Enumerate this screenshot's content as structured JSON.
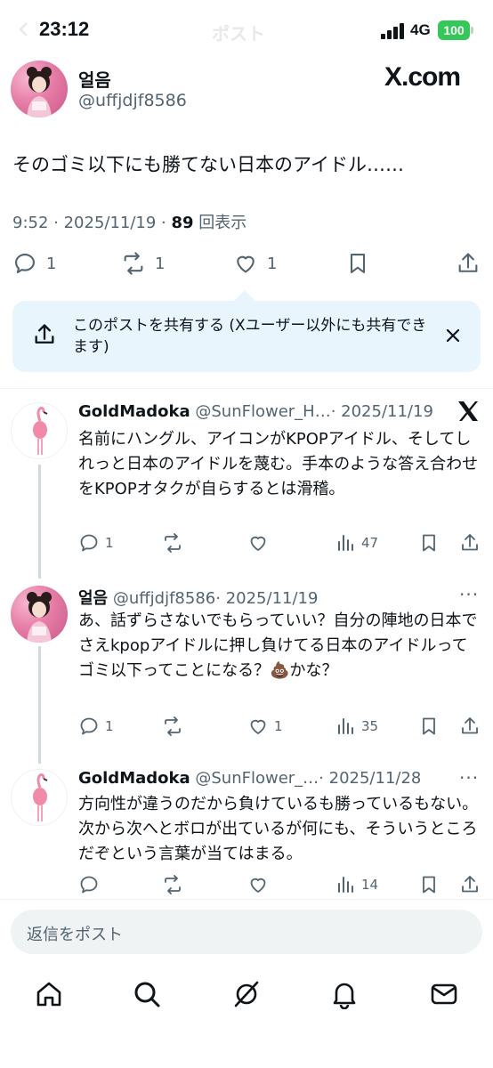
{
  "status_bar": {
    "time": "23:12",
    "screen_title": "ポスト",
    "network": "4G",
    "battery": "100"
  },
  "post": {
    "display_name": "얼음",
    "handle": "@uffjdjf8586",
    "watermark": "X.com",
    "text": "そのゴミ以下にも勝てない日本のアイドル……",
    "timestamp": "9:52 · 2025/11/19 · ",
    "views_count": "89",
    "views_label": " 回表示",
    "actions": {
      "reply_count": "1",
      "repost_count": "1",
      "like_count": "1"
    }
  },
  "share_banner": {
    "text": "このポストを共有する (Xユーザー以外にも共有できます)"
  },
  "replies": [
    {
      "name": "GoldMadoka",
      "handle": "@SunFlower_H…",
      "date": "· 2025/11/19",
      "text": "名前にハングル、アイコンがKPOPアイドル、そしてしれっと日本のアイドルを蔑む。手本のような答え合わせをKPOPオタクが自らするとは滑稽。",
      "reply_count": "1",
      "repost_count": "",
      "like_count": "",
      "views": "47"
    },
    {
      "name": "얼음",
      "handle": "@uffjdjf8586",
      "date": "· 2025/11/19",
      "text": "あ、話ずらさないでもらっていい？自分の陣地の日本でさえkpopアイドルに押し負けてる日本のアイドルってゴミ以下ってことになる？💩かな？",
      "reply_count": "1",
      "repost_count": "",
      "like_count": "1",
      "views": "35"
    },
    {
      "name": "GoldMadoka",
      "handle": "@SunFlower_…",
      "date": "· 2025/11/28",
      "text": "方向性が違うのだから負けているも勝っているもない。次から次へとボロが出ているが何にも、そういうところだぞという言葉が当てはまる。",
      "reply_count": "",
      "repost_count": "",
      "like_count": "",
      "views": "14"
    }
  ],
  "reply_box": {
    "placeholder": "返信をポスト"
  },
  "colors": {
    "text": "#0f1419",
    "muted": "#536471",
    "share_bg": "#e8f5fd",
    "battery": "#34c759"
  },
  "icons": [
    "back-icon",
    "signal-icon",
    "reply-icon",
    "repost-icon",
    "like-icon",
    "bookmark-icon",
    "share-icon",
    "close-icon",
    "views-icon",
    "more-icon",
    "x-logo-icon",
    "home-icon",
    "search-icon",
    "grok-icon",
    "notifications-icon",
    "messages-icon"
  ]
}
